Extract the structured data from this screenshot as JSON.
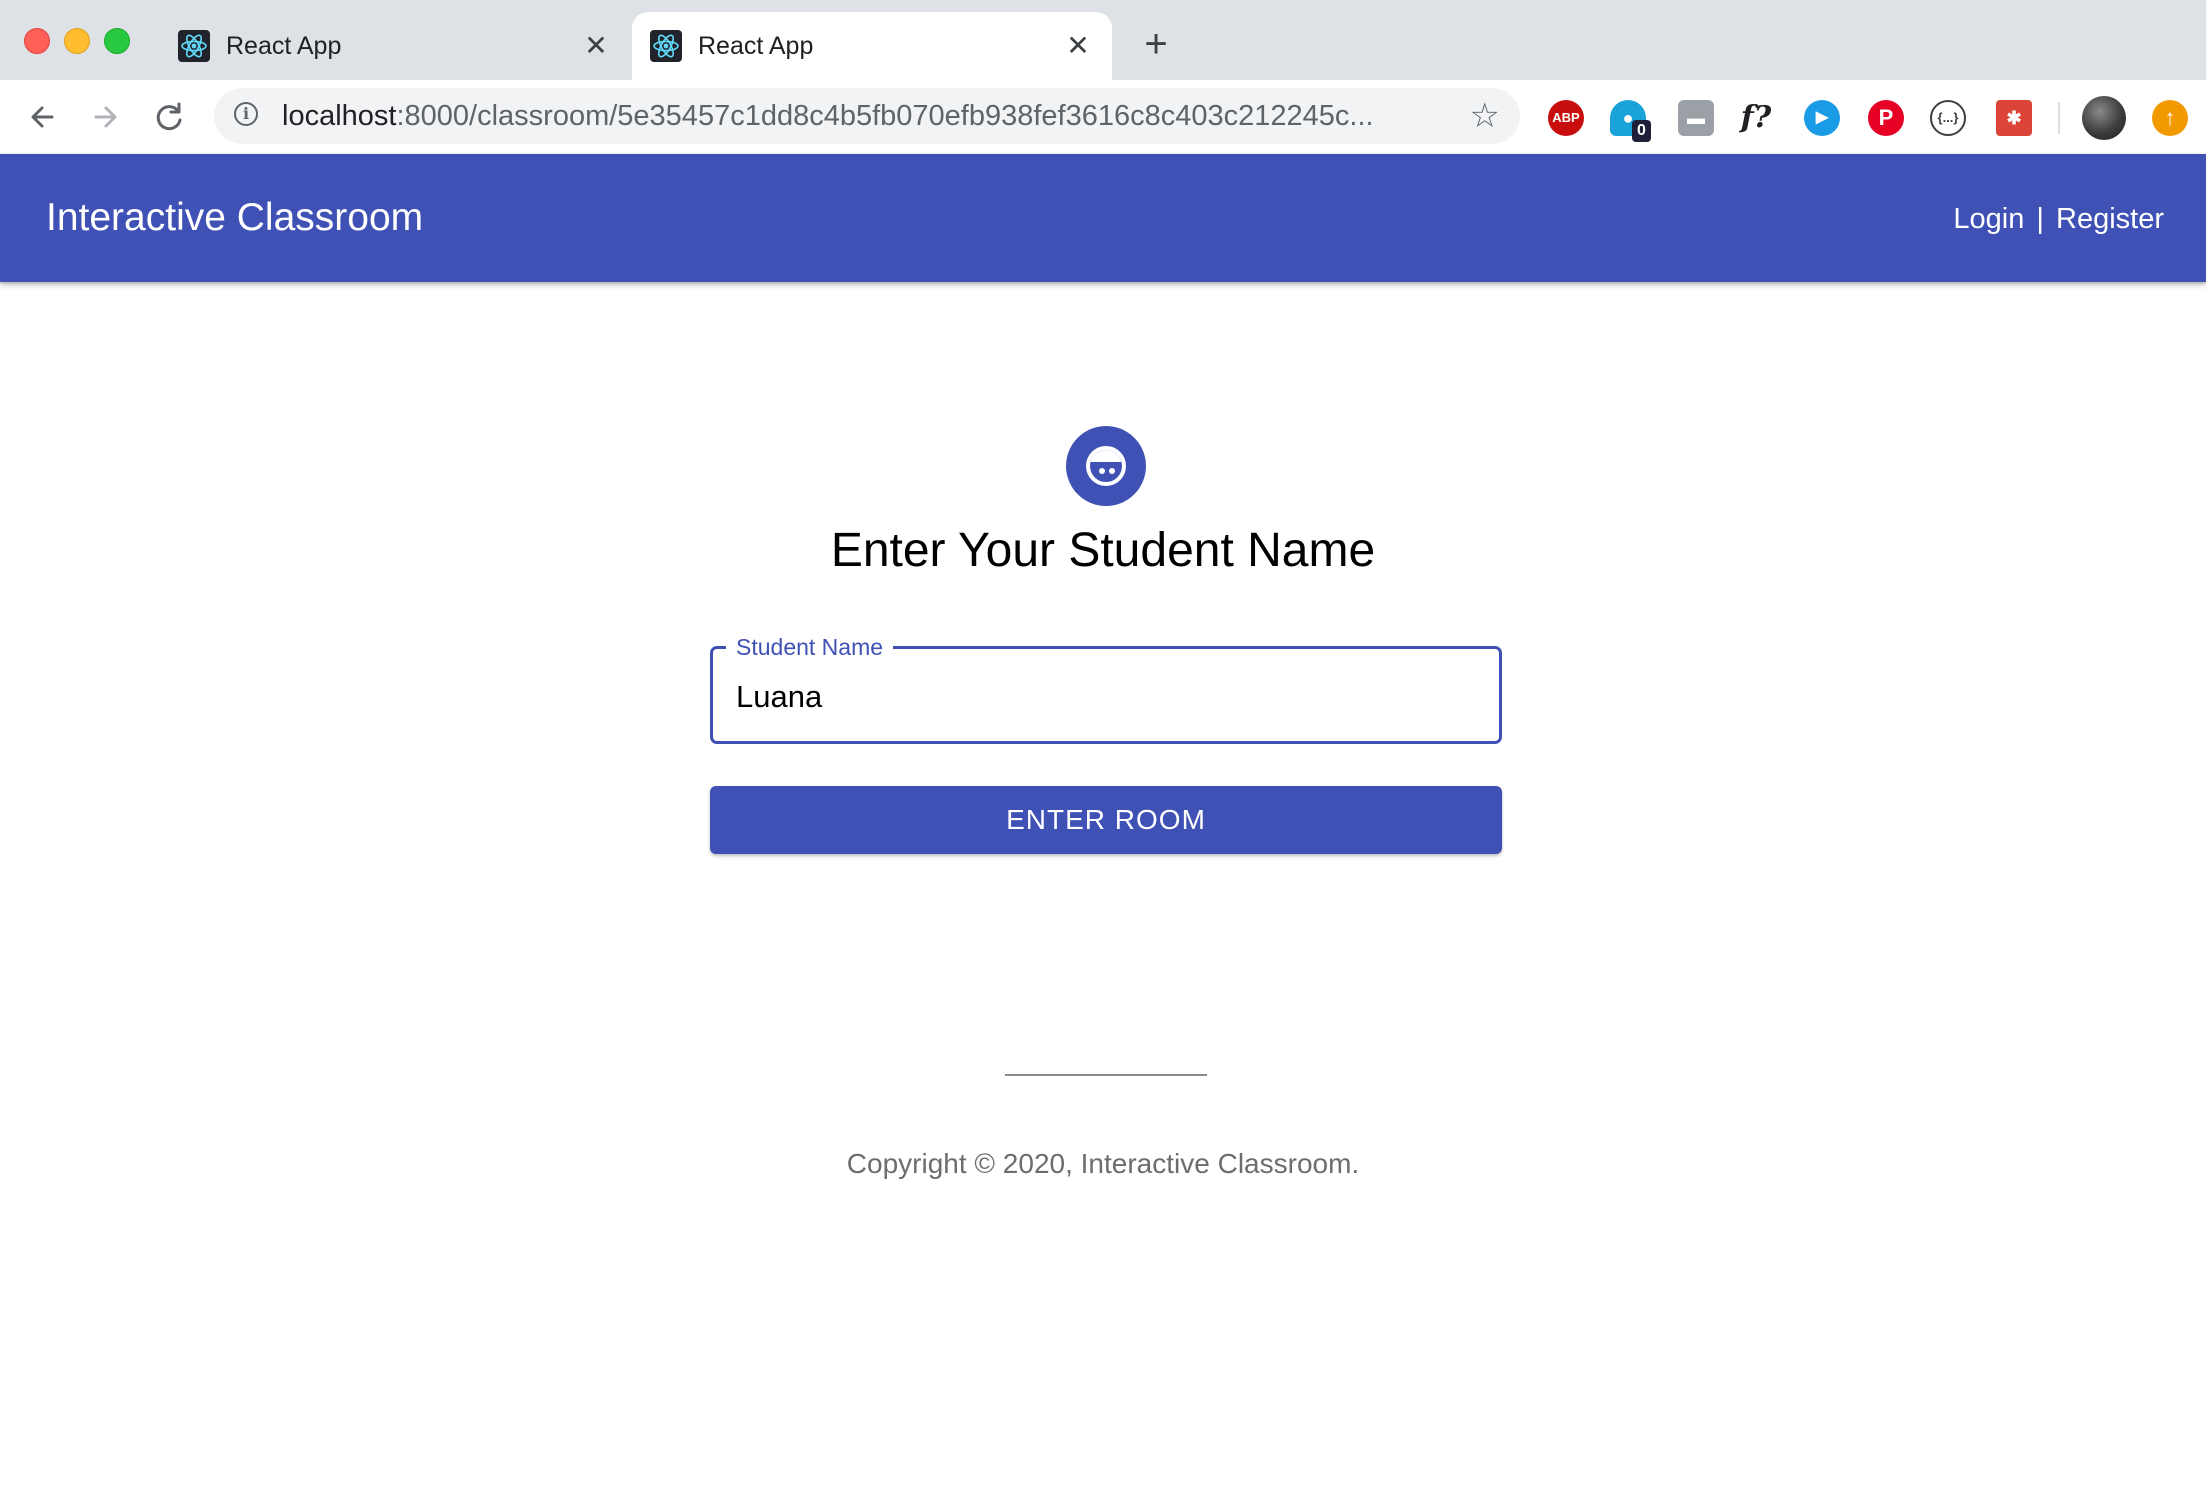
{
  "browser": {
    "tabs": [
      {
        "title": "React App",
        "close": "✕"
      },
      {
        "title": "React App",
        "close": "✕"
      }
    ],
    "new_tab": "+",
    "url_host": "localhost",
    "url_rest": ":8000/classroom/5e35457c1dd8c4b5fb070efb938fef3616c8c403c212245c...",
    "extensions": {
      "abp": "ABP",
      "ghostery_badge": "0",
      "font_finder": "f?",
      "json_viewer": "{...}"
    },
    "icons": [
      "back-arrow-icon",
      "forward-arrow-icon",
      "reload-icon",
      "info-icon",
      "star-icon",
      "update-icon"
    ]
  },
  "appbar": {
    "title": "Interactive Classroom",
    "login": "Login",
    "separator": "|",
    "register": "Register"
  },
  "form": {
    "heading": "Enter Your Student Name",
    "field_label": "Student Name",
    "field_value": "Luana",
    "button_label": "ENTER ROOM"
  },
  "footer": {
    "copyright": "Copyright © 2020, Interactive Classroom."
  },
  "colors": {
    "primary": "#3f51b5",
    "tabbar": "#dee1e6",
    "footer_text": "#6d6d6d"
  }
}
